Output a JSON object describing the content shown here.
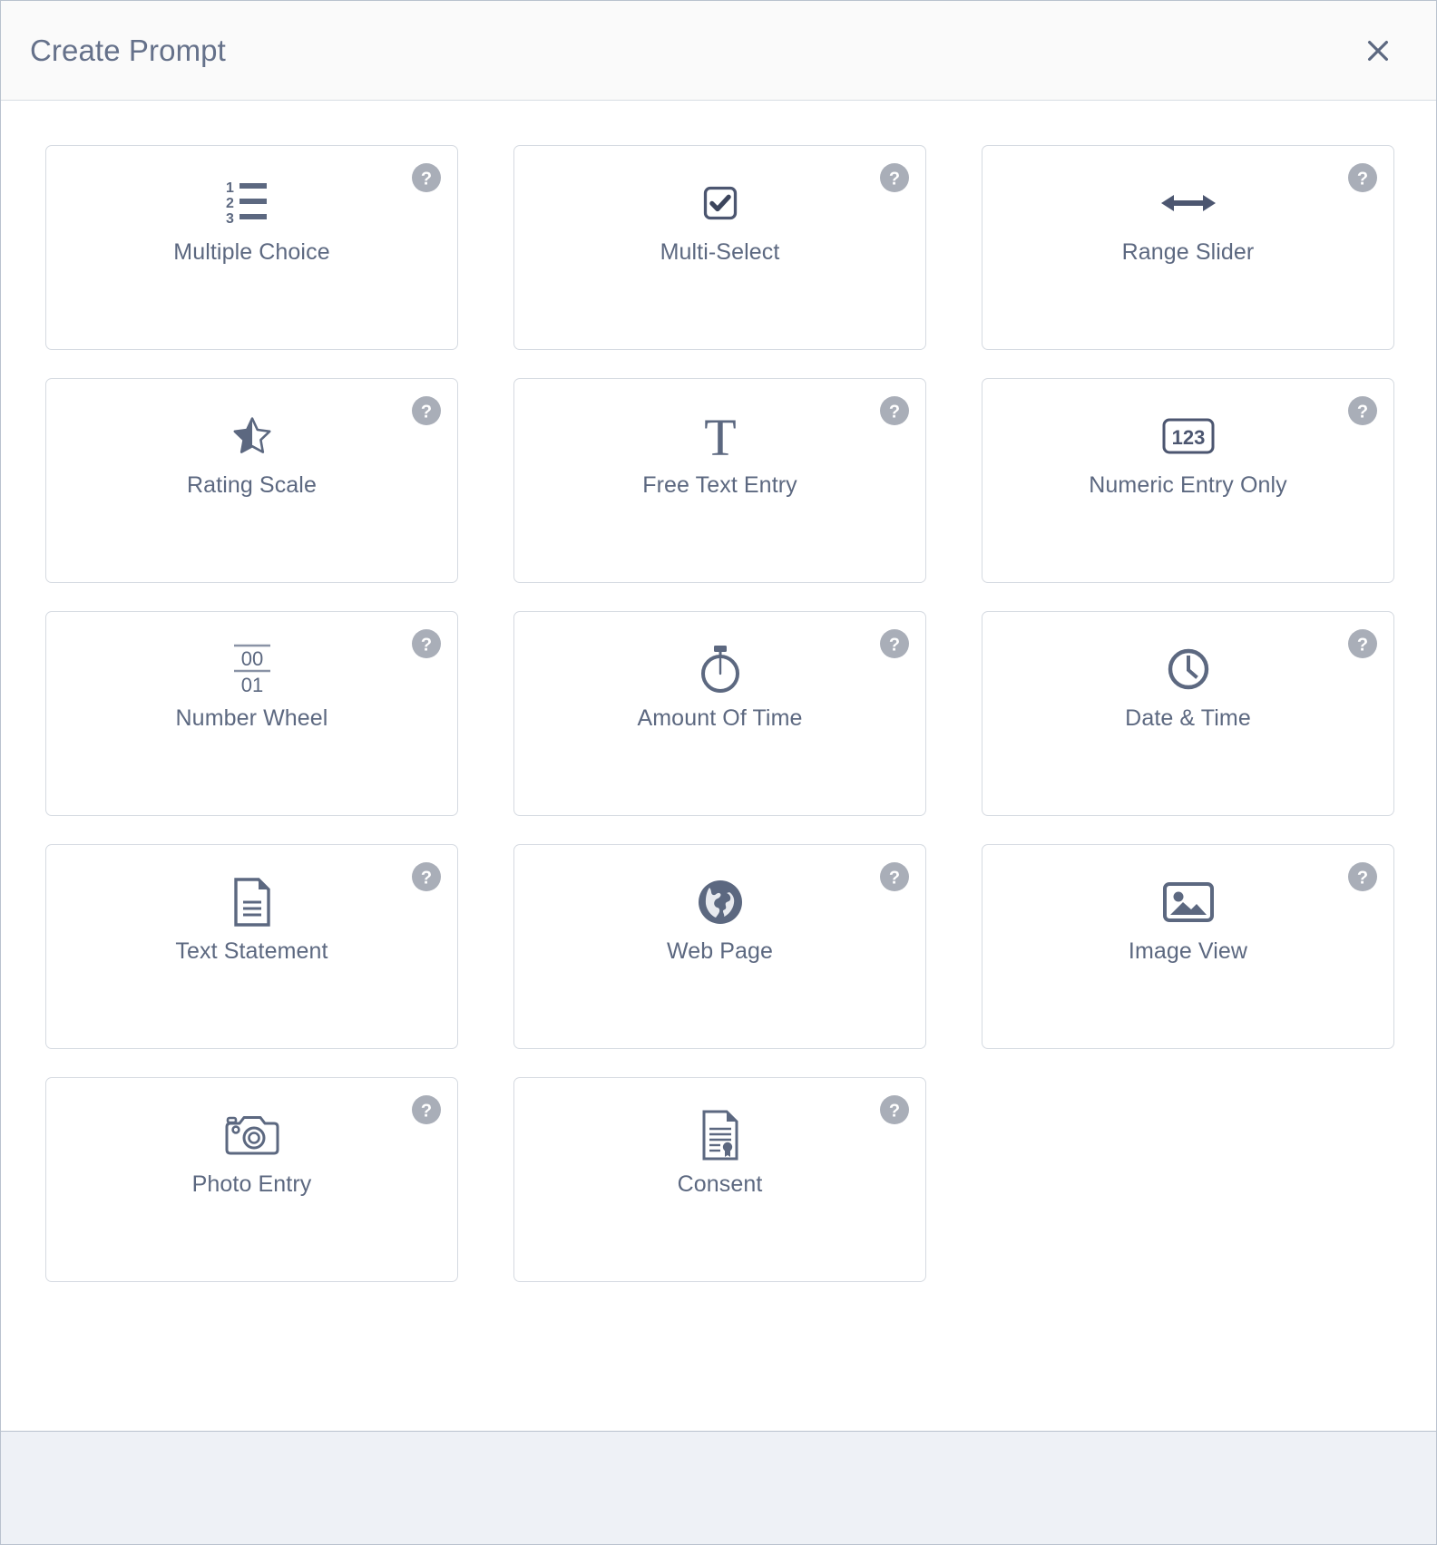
{
  "modal": {
    "title": "Create Prompt",
    "close_icon": "close-icon",
    "close_label": "Close"
  },
  "prompt_types": [
    {
      "id": "multiple-choice",
      "label": "Multiple Choice",
      "icon": "numbered-list-icon",
      "help_icon": "question-mark-icon",
      "help_label": "?"
    },
    {
      "id": "multi-select",
      "label": "Multi-Select",
      "icon": "checkbox-checked-icon",
      "help_icon": "question-mark-icon",
      "help_label": "?"
    },
    {
      "id": "range-slider",
      "label": "Range Slider",
      "icon": "left-right-arrow-icon",
      "help_icon": "question-mark-icon",
      "help_label": "?"
    },
    {
      "id": "rating-scale",
      "label": "Rating Scale",
      "icon": "half-star-icon",
      "help_icon": "question-mark-icon",
      "help_label": "?"
    },
    {
      "id": "free-text-entry",
      "label": "Free Text Entry",
      "icon": "letter-t-icon",
      "help_icon": "question-mark-icon",
      "help_label": "?"
    },
    {
      "id": "numeric-entry-only",
      "label": "Numeric Entry Only",
      "icon": "numeric-123-icon",
      "help_icon": "question-mark-icon",
      "help_label": "?"
    },
    {
      "id": "number-wheel",
      "label": "Number Wheel",
      "icon": "number-wheel-icon",
      "help_icon": "question-mark-icon",
      "help_label": "?"
    },
    {
      "id": "amount-of-time",
      "label": "Amount Of Time",
      "icon": "stopwatch-icon",
      "help_icon": "question-mark-icon",
      "help_label": "?"
    },
    {
      "id": "date-and-time",
      "label": "Date & Time",
      "icon": "clock-icon",
      "help_icon": "question-mark-icon",
      "help_label": "?"
    },
    {
      "id": "text-statement",
      "label": "Text Statement",
      "icon": "document-icon",
      "help_icon": "question-mark-icon",
      "help_label": "?"
    },
    {
      "id": "web-page",
      "label": "Web Page",
      "icon": "globe-icon",
      "help_icon": "question-mark-icon",
      "help_label": "?"
    },
    {
      "id": "image-view",
      "label": "Image View",
      "icon": "picture-icon",
      "help_icon": "question-mark-icon",
      "help_label": "?"
    },
    {
      "id": "photo-entry",
      "label": "Photo Entry",
      "icon": "camera-icon",
      "help_icon": "question-mark-icon",
      "help_label": "?"
    },
    {
      "id": "consent",
      "label": "Consent",
      "icon": "certificate-icon",
      "help_icon": "question-mark-icon",
      "help_label": "?"
    }
  ],
  "number_wheel_icon_text": {
    "top": "00",
    "bottom": "01"
  },
  "numeric_icon_text": "123",
  "letter_t_icon_text": "T",
  "colors": {
    "icon": "#5c6880",
    "label": "#5c6880",
    "title": "#65718a",
    "card_border": "#d5dae1",
    "header_bg": "#fafafa",
    "footer_bg": "#eef1f6",
    "help_badge_bg": "#a9aeb8"
  },
  "footer": {
    "content": ""
  }
}
